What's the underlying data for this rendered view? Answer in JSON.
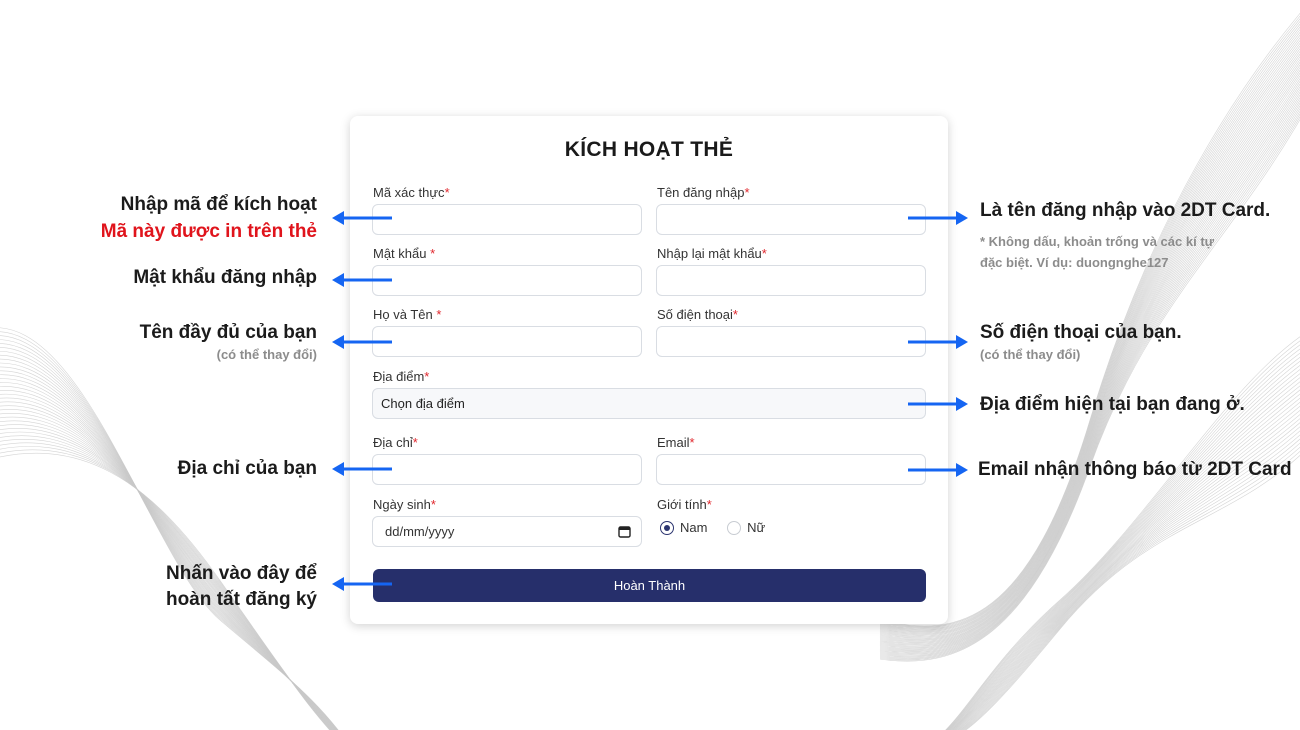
{
  "form": {
    "title": "KÍCH HOẠT THẺ",
    "required_mark": "*",
    "fields": {
      "code": {
        "label": "Mã xác thực",
        "value": ""
      },
      "username": {
        "label": "Tên đăng nhập",
        "value": ""
      },
      "password": {
        "label": "Mật khẩu ",
        "value": ""
      },
      "confirm_password": {
        "label": "Nhập lại mật khẩu",
        "value": ""
      },
      "fullname": {
        "label": "Họ và Tên ",
        "value": ""
      },
      "phone": {
        "label": "Số điện thoại",
        "value": ""
      },
      "location": {
        "label": "Địa điểm",
        "selected": "Chọn địa điểm"
      },
      "address": {
        "label": "Địa chỉ",
        "value": ""
      },
      "email": {
        "label": "Email",
        "value": ""
      },
      "birthday": {
        "label": "Ngày sinh",
        "placeholder": "dd/mm/yyyy"
      },
      "gender": {
        "label": "Giới tính",
        "options": [
          "Nam",
          "Nữ"
        ],
        "selected": "Nam"
      }
    },
    "submit_label": "Hoàn Thành"
  },
  "annotations": {
    "left": {
      "code_line1": "Nhập mã để kích hoạt",
      "code_line2": "Mã này được in trên thẻ",
      "password": "Mật khẩu đăng nhập",
      "fullname": "Tên đầy đủ của bạn",
      "fullname_note": "(có thể thay đổi)",
      "address": "Địa chỉ của bạn",
      "submit_line1": "Nhấn vào đây để",
      "submit_line2": "hoàn tất đăng ký"
    },
    "right": {
      "username": "Là tên đăng nhập vào 2DT Card.",
      "username_note_line1": "* Không dấu, khoản trống và các kí tự",
      "username_note_line2": "đặc biệt. Ví dụ: duongnghe127",
      "phone": "Số điện thoại của bạn.",
      "phone_note": "(có thể thay đổi)",
      "location": "Địa điểm hiện tại bạn đang ở.",
      "email": "Email nhận thông báo từ 2DT Card"
    }
  },
  "colors": {
    "arrow": "#1565f2",
    "button": "#262f6b",
    "required": "#e0262c",
    "highlight_text": "#e0141c"
  }
}
